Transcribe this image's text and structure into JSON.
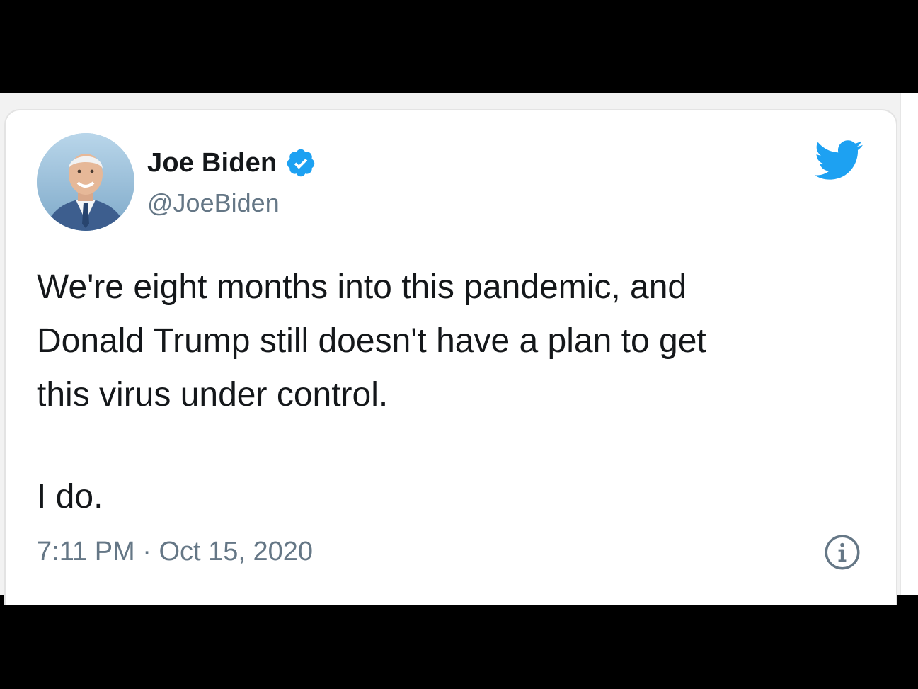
{
  "tweet": {
    "display_name": "Joe Biden",
    "handle": "@JoeBiden",
    "text_paragraph_1": "We're eight months into this pandemic, and\nDonald Trump still doesn't have a plan to get\nthis virus under control.",
    "text_paragraph_2": "I do.",
    "timestamp": "7:11 PM · Oct 15, 2020",
    "verified": true
  },
  "icons": {
    "avatar": "profile-photo",
    "verified": "verified-badge-icon",
    "brand": "twitter-bird-icon",
    "info": "info-icon"
  },
  "colors": {
    "brand_blue": "#1da1f2",
    "text_primary": "#14171a",
    "text_secondary": "#657786"
  }
}
